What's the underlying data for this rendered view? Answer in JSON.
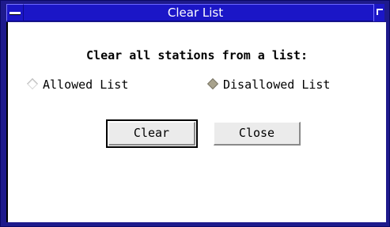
{
  "window": {
    "title": "Clear List"
  },
  "dialog": {
    "heading": "Clear all stations from a list:",
    "options": [
      {
        "label": "Allowed List",
        "selected": false
      },
      {
        "label": "Disallowed List",
        "selected": true
      }
    ],
    "buttons": {
      "clear": "Clear",
      "close": "Close"
    }
  },
  "colors": {
    "titlebar": "#1b16c7",
    "frame": "#1e1a8c",
    "button_face": "#ebebeb",
    "radio_selected": "#a8a28c"
  }
}
